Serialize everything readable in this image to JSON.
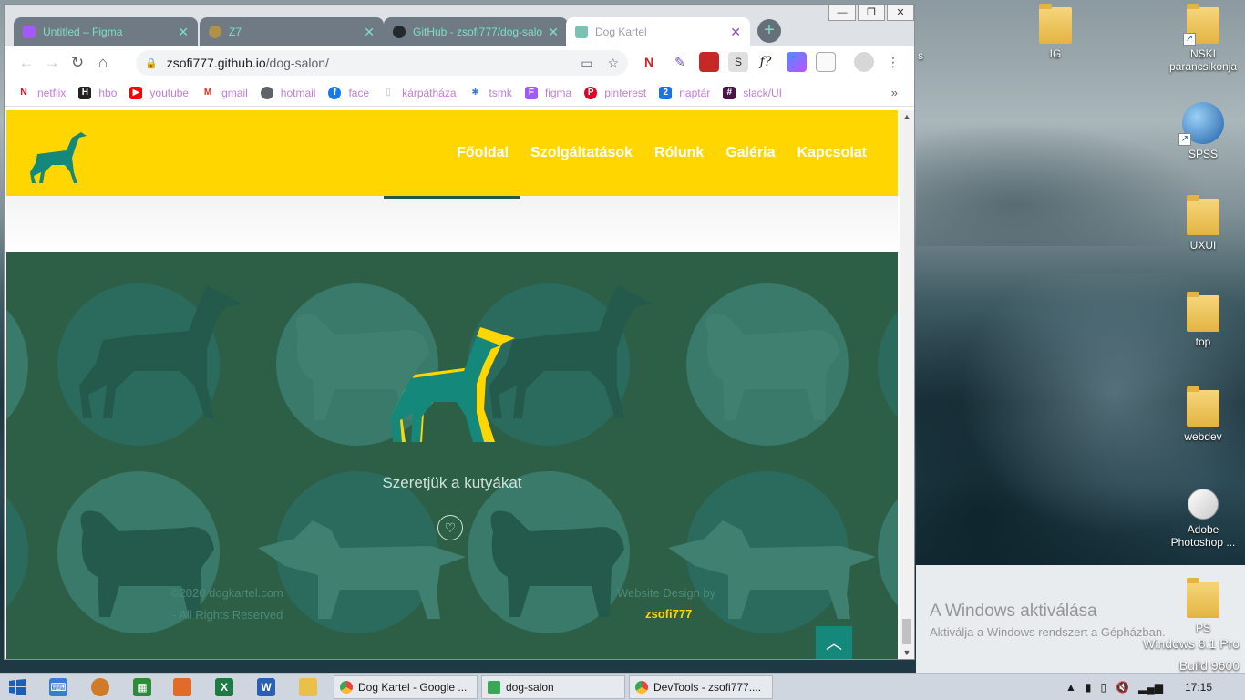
{
  "desktop": {
    "icons": [
      {
        "name": "IG",
        "label": "IG"
      },
      {
        "name": "nski",
        "label": "NSKI parancsikonja"
      },
      {
        "name": "spss",
        "label": "SPSS"
      },
      {
        "name": "uxui",
        "label": "UXUI"
      },
      {
        "name": "top",
        "label": "top"
      },
      {
        "name": "webdev",
        "label": "webdev"
      },
      {
        "name": "photoshop",
        "label": "Adobe Photoshop ..."
      },
      {
        "name": "ps",
        "label": "PS"
      }
    ],
    "stray_label": "s",
    "activation_title": "A Windows aktiválása",
    "activation_sub": "Aktiválja a Windows rendszert a Gépházban.",
    "os_name": "Windows 8.1 Pro",
    "os_build": "Build 9600"
  },
  "browser": {
    "tabs": [
      {
        "label": "Untitled – Figma",
        "color": "#a259ff"
      },
      {
        "label": "Z7",
        "color": "#b0914a"
      },
      {
        "label": "GitHub - zsofi777/dog-salon",
        "color": "#24292e"
      },
      {
        "label": "Dog Kartel",
        "color": "#7bc2b4"
      }
    ],
    "url_host": "zsofi777.github.io",
    "url_path": "/dog-salon/",
    "bookmarks": [
      {
        "label": "netflix",
        "color": "#e50914",
        "glyph": "N"
      },
      {
        "label": "hbo",
        "color": "#222222",
        "glyph": "H"
      },
      {
        "label": "youtube",
        "color": "#ff0000",
        "glyph": "▶"
      },
      {
        "label": "gmail",
        "color": "#d93025",
        "glyph": "M"
      },
      {
        "label": "hotmail",
        "color": "#5f6368",
        "glyph": "◉"
      },
      {
        "label": "face",
        "color": "#1877f2",
        "glyph": "f"
      },
      {
        "label": "kárpátháza",
        "color": "#bdbdbd",
        "glyph": "▯"
      },
      {
        "label": "tsmk",
        "color": "#3f7ad6",
        "glyph": "✱"
      },
      {
        "label": "figma",
        "color": "#a259ff",
        "glyph": "F"
      },
      {
        "label": "pinterest",
        "color": "#e60023",
        "glyph": "P"
      },
      {
        "label": "naptár",
        "color": "#1a73e8",
        "glyph": "2"
      },
      {
        "label": "slack/UI",
        "color": "#4a154b",
        "glyph": "#"
      }
    ]
  },
  "site": {
    "nav": [
      "Főoldal",
      "Szolgáltatások",
      "Rólunk",
      "Galéria",
      "Kapcsolat"
    ],
    "tagline": "Szeretjük a kutyákat",
    "copyright_line1": "©2020 dogkartel.com",
    "copyright_line2": "- All Rights Reserved",
    "design_line1": "Website Design by",
    "design_author": "zsofi777"
  },
  "taskbar": {
    "tasks": [
      {
        "label": "Dog Kartel - Google ...",
        "color": "#e8453c"
      },
      {
        "label": "dog-salon",
        "color": "#3aa657"
      },
      {
        "label": "DevTools - zsofi777....",
        "color": "#e8453c"
      }
    ],
    "time": "17:15"
  },
  "colors": {
    "brand_yellow": "#ffd600",
    "brand_green": "#2d5e46",
    "teal": "#14887a"
  }
}
